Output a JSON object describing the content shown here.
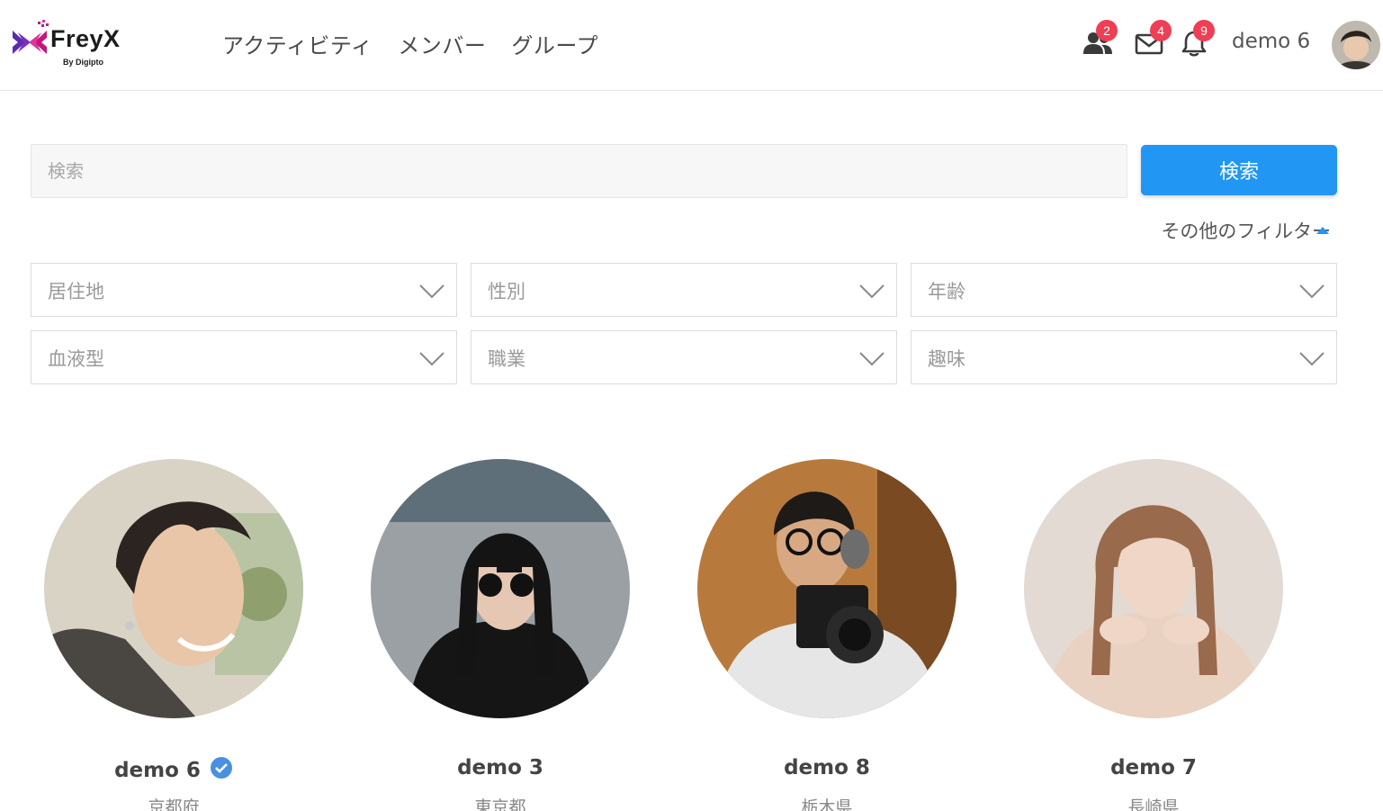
{
  "brand": {
    "name": "FreyX",
    "sub": "By Digipto"
  },
  "nav": {
    "items": [
      {
        "label": "アクティビティ"
      },
      {
        "label": "メンバー"
      },
      {
        "label": "グループ"
      }
    ]
  },
  "header": {
    "friend_requests_count": "2",
    "messages_count": "4",
    "notifications_count": "9",
    "user_name": "demo 6"
  },
  "search": {
    "placeholder": "検索",
    "value": "",
    "button_label": "検索"
  },
  "filters": {
    "toggle_label": "その他のフィルター",
    "items": [
      {
        "label": "居住地"
      },
      {
        "label": "性別"
      },
      {
        "label": "年齢"
      },
      {
        "label": "血液型"
      },
      {
        "label": "職業"
      },
      {
        "label": "趣味"
      }
    ]
  },
  "members": [
    {
      "name": "demo 6",
      "location": "京都府",
      "verified": true
    },
    {
      "name": "demo 3",
      "location": "東京都",
      "verified": false
    },
    {
      "name": "demo 8",
      "location": "栃木県",
      "verified": false
    },
    {
      "name": "demo 7",
      "location": "長崎県",
      "verified": false
    }
  ],
  "colors": {
    "accent": "#2196f3",
    "badge": "#ee3f55",
    "logo_purple": "#7b2fbf",
    "logo_magenta": "#c2187a"
  }
}
